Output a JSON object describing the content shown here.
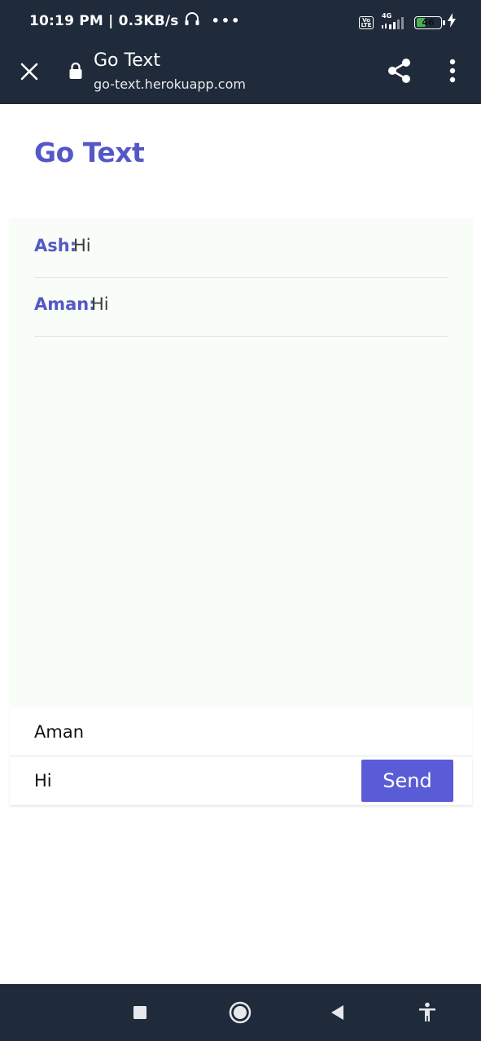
{
  "status_bar": {
    "time_speed": "10:19 PM | 0.3KB/s",
    "overflow_dots": "•••",
    "volte": "Vo\nLTE",
    "network_type": "4G",
    "battery_level": "46",
    "battery_fraction": 0.46,
    "colors": {
      "battery_fill": "#4caf50"
    }
  },
  "browser": {
    "title": "Go Text",
    "url": "go-text.herokuapp.com",
    "icons": [
      "close-icon",
      "lock-icon",
      "share-icon",
      "more-vert-icon"
    ]
  },
  "page": {
    "heading": "Go Text",
    "accent_color": "#5458c7"
  },
  "chat": {
    "messages": [
      {
        "author": "Ash:",
        "text": "Hi"
      },
      {
        "author": "Aman:",
        "text": "Hi"
      }
    ]
  },
  "form": {
    "name_value": "Aman",
    "message_value": "Hi",
    "send_label": "Send",
    "send_color": "#5a5bd6"
  },
  "nav": {
    "icons": [
      "recents-square-icon",
      "home-circle-icon",
      "back-triangle-icon",
      "accessibility-icon"
    ]
  }
}
